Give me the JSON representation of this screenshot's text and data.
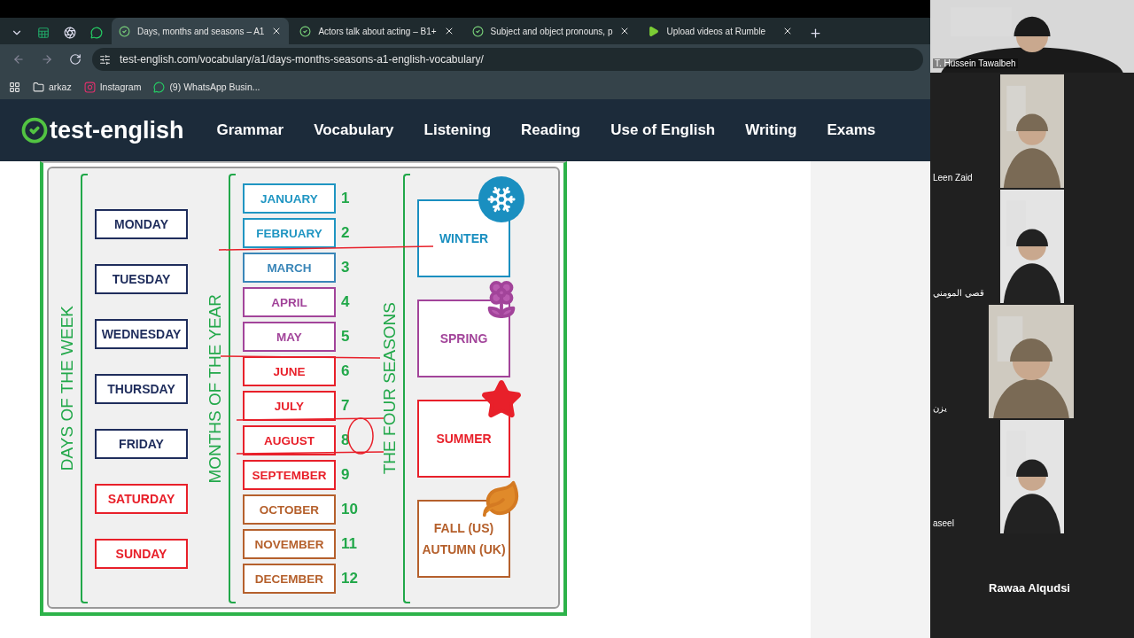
{
  "browser": {
    "tabs": [
      {
        "title": "Days, months and seasons – A1",
        "kind": "check",
        "selected": true
      },
      {
        "title": "Actors talk about acting – B1+",
        "kind": "check",
        "selected": false
      },
      {
        "title": "Subject and object pronouns, p",
        "kind": "check",
        "selected": false
      },
      {
        "title": "Upload videos at Rumble",
        "kind": "play",
        "selected": false
      }
    ],
    "address": "test-english.com/vocabulary/a1/days-months-seasons-a1-english-vocabulary/",
    "bookmarks": [
      {
        "label": "arkaz",
        "kind": "folder"
      },
      {
        "label": "Instagram",
        "kind": "instagram"
      },
      {
        "label": "(9) WhatsApp Busin...",
        "kind": "whatsapp"
      }
    ]
  },
  "site": {
    "logo": "test-english",
    "nav": [
      "Grammar",
      "Vocabulary",
      "Listening",
      "Reading",
      "Use of English",
      "Writing",
      "Exams"
    ]
  },
  "chart": {
    "days_title": "DAYS OF THE WEEK",
    "days": [
      {
        "label": "MONDAY",
        "color": "#1f2d5c"
      },
      {
        "label": "TUESDAY",
        "color": "#1f2d5c"
      },
      {
        "label": "WEDNESDAY",
        "color": "#1f2d5c"
      },
      {
        "label": "THURSDAY",
        "color": "#1f2d5c"
      },
      {
        "label": "FRIDAY",
        "color": "#1f2d5c"
      },
      {
        "label": "SATURDAY",
        "color": "#e8202a"
      },
      {
        "label": "SUNDAY",
        "color": "#e8202a"
      }
    ],
    "months_title": "MONTHS OF THE YEAR",
    "months": [
      {
        "label": "JANUARY",
        "number": "1",
        "color": "#1f95c2"
      },
      {
        "label": "FEBRUARY",
        "number": "2",
        "color": "#1f95c2"
      },
      {
        "label": "MARCH",
        "number": "3",
        "color": "#3a86b8"
      },
      {
        "label": "APRIL",
        "number": "4",
        "color": "#a2449a"
      },
      {
        "label": "MAY",
        "number": "5",
        "color": "#a2449a"
      },
      {
        "label": "JUNE",
        "number": "6",
        "color": "#e8202a"
      },
      {
        "label": "JULY",
        "number": "7",
        "color": "#e8202a"
      },
      {
        "label": "AUGUST",
        "number": "8",
        "color": "#e8202a"
      },
      {
        "label": "SEPTEMBER",
        "number": "9",
        "color": "#e8202a"
      },
      {
        "label": "OCTOBER",
        "number": "10",
        "color": "#b5602c"
      },
      {
        "label": "NOVEMBER",
        "number": "11",
        "color": "#b5602c"
      },
      {
        "label": "DECEMBER",
        "number": "12",
        "color": "#b5602c"
      }
    ],
    "seasons_title": "THE FOUR SEASONS",
    "seasons": [
      {
        "lines": [
          "WINTER"
        ],
        "kind": "snow",
        "color": "#1a8fc0"
      },
      {
        "lines": [
          "SPRING"
        ],
        "kind": "flower",
        "color": "#a2449a"
      },
      {
        "lines": [
          "SUMMER"
        ],
        "kind": "star",
        "color": "#e8202a"
      },
      {
        "lines": [
          "FALL (US)",
          "AUTUMN (UK)"
        ],
        "kind": "leaf",
        "color": "#b5602c"
      }
    ]
  },
  "call": {
    "participants": [
      {
        "name": "T. Hussein Tawalbeh",
        "kind": "main"
      },
      {
        "name": "Leen Zaid",
        "kind": "tile"
      },
      {
        "name": "قصي المومني",
        "kind": "tile"
      },
      {
        "name": "يزن",
        "kind": "wide"
      },
      {
        "name": "aseel",
        "kind": "tile"
      }
    ],
    "speaker": "Rawaa Alqudsi"
  }
}
